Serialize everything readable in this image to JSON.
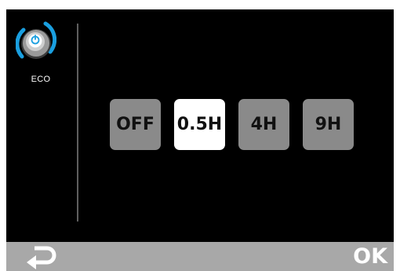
{
  "mode": {
    "icon": "eco-power-knob-icon",
    "label": "ECO"
  },
  "timer_options": [
    {
      "label": "OFF",
      "selected": false
    },
    {
      "label": "0.5H",
      "selected": true
    },
    {
      "label": "4H",
      "selected": false
    },
    {
      "label": "9H",
      "selected": false
    }
  ],
  "footer": {
    "back_icon": "return-arrow-icon",
    "ok_label": "OK"
  },
  "colors": {
    "screen_background": "#000000",
    "button_default": "#8a8a8a",
    "button_selected": "#ffffff",
    "footer_background": "#a8a8a8",
    "accent_blue": "#1a9fe0"
  }
}
